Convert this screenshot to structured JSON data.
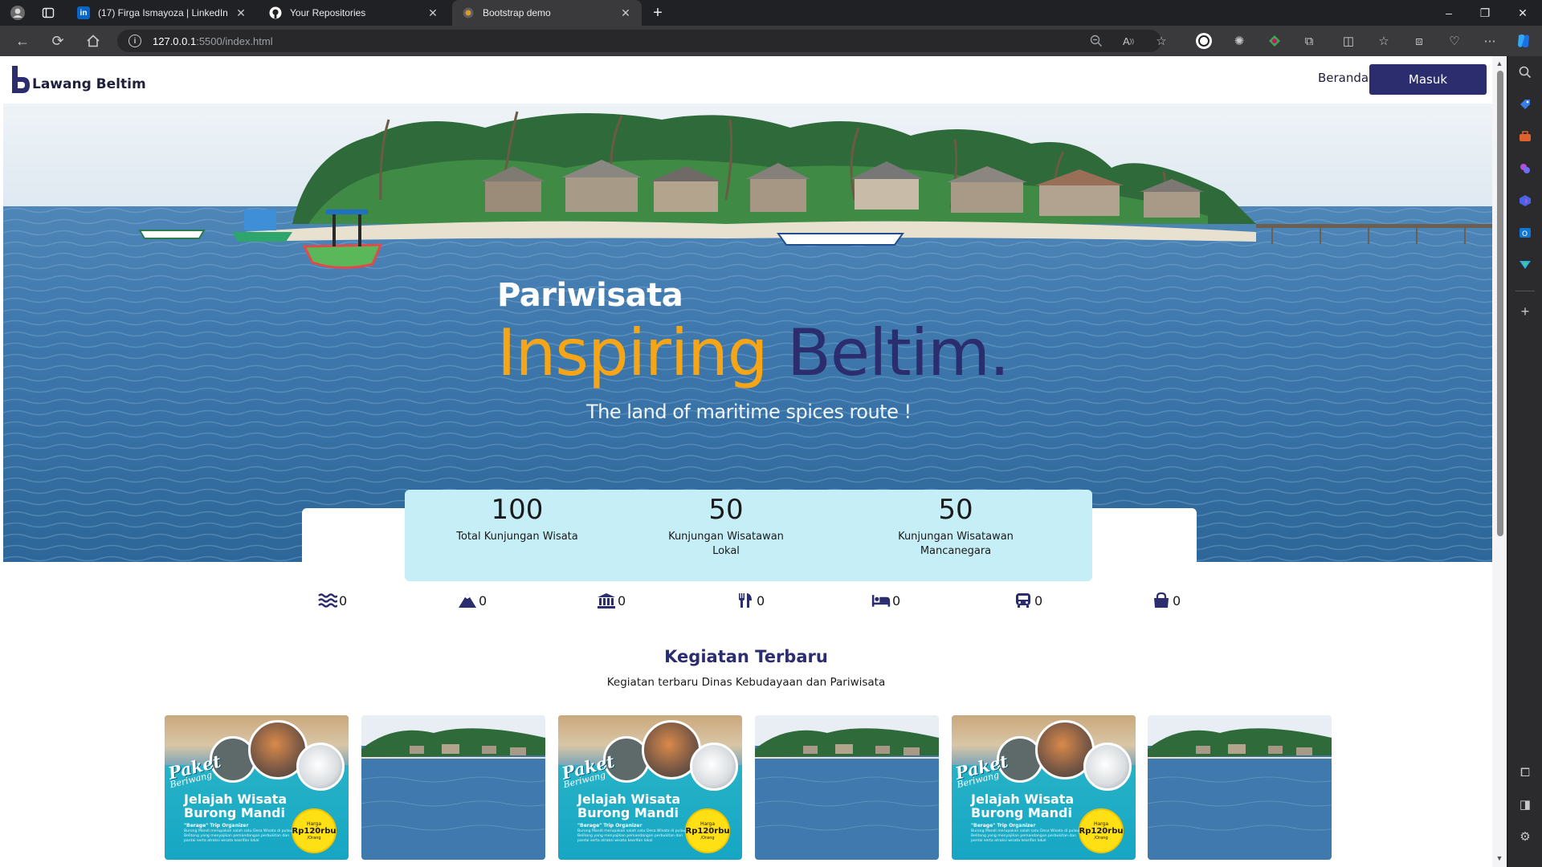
{
  "browser": {
    "tabs": [
      {
        "title": "(17) Firga Ismayoza | LinkedIn",
        "favicon": "linkedin-icon",
        "color": "#0a66c2"
      },
      {
        "title": "Your Repositories",
        "favicon": "github-icon",
        "color": "#ffffff"
      },
      {
        "title": "Bootstrap demo",
        "favicon": "bootstrap-icon",
        "color": "#7952b3"
      }
    ],
    "url_host": "127.0.0.1",
    "url_path": ":5500/index.html"
  },
  "site": {
    "brand": "Lawang Beltim",
    "nav": {
      "home": "Beranda",
      "login": "Masuk"
    }
  },
  "hero": {
    "kicker": "Pariwisata",
    "title_accent": "Inspiring",
    "title_main": "Beltim.",
    "subtitle": "The land of maritime spices route !"
  },
  "stats": [
    {
      "value": "100",
      "label": "Total Kunjungan Wisata"
    },
    {
      "value": "50",
      "label": "Kunjungan Wisatawan Lokal"
    },
    {
      "value": "50",
      "label": "Kunjungan Wisatawan Mancanegara"
    }
  ],
  "facilities": [
    {
      "icon": "water-icon",
      "count": "0"
    },
    {
      "icon": "mountain-icon",
      "count": "0"
    },
    {
      "icon": "museum-icon",
      "count": "0"
    },
    {
      "icon": "restaurant-icon",
      "count": "0"
    },
    {
      "icon": "hotel-bed-icon",
      "count": "0"
    },
    {
      "icon": "bus-icon",
      "count": "0"
    },
    {
      "icon": "shopping-bag-icon",
      "count": "0"
    }
  ],
  "section": {
    "title": "Kegiatan Terbaru",
    "subtitle": "Kegiatan terbaru Dinas Kebudayaan dan Pariwisata"
  },
  "promo": {
    "paket": "Paket",
    "beriwang": "Beriwang",
    "title_line1": "Jelajah Wisata",
    "title_line2": "Burong Mandi",
    "organizer": "\"Berage\" Trip Organizer",
    "body": "Burong Mandi merupakan salah satu Desa Wisata di pulau Belitong yang menyajikan pemandangan perbukitan dan pantai serta atraksi wisata kearifan lokal",
    "price_label": "Harga",
    "price": "Rp120rbu",
    "per": "/Orang"
  },
  "colors": {
    "navy": "#2b2d6e",
    "accent": "#f5a516",
    "stat_panel": "#c6eef6"
  }
}
